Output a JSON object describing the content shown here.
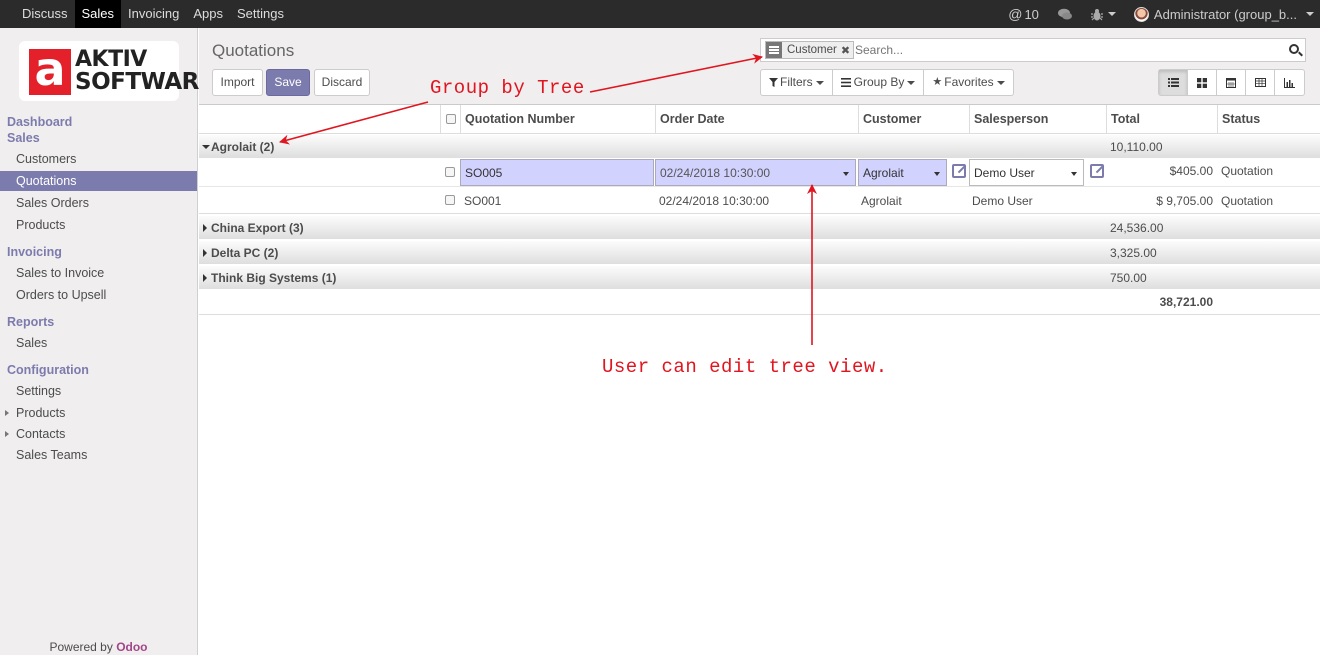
{
  "topbar": {
    "menu": [
      {
        "label": "Discuss",
        "active": false
      },
      {
        "label": "Sales",
        "active": true
      },
      {
        "label": "Invoicing",
        "active": false
      },
      {
        "label": "Apps",
        "active": false
      },
      {
        "label": "Settings",
        "active": false
      }
    ],
    "mentions_count": "10",
    "user_label": "Administrator (group_b..."
  },
  "sidebar": {
    "logo_top": "AKTIV",
    "logo_bottom": "SOFTWARE",
    "logo_letter": "a",
    "sections": {
      "dashboard": "Dashboard",
      "sales": "Sales",
      "invoicing": "Invoicing",
      "reports": "Reports",
      "configuration": "Configuration"
    },
    "items": {
      "customers": "Customers",
      "quotations": "Quotations",
      "sales_orders": "Sales Orders",
      "products": "Products",
      "sales_to_invoice": "Sales to Invoice",
      "orders_to_upsell": "Orders to Upsell",
      "reports_sales": "Sales",
      "settings": "Settings",
      "config_products": "Products",
      "contacts": "Contacts",
      "sales_teams": "Sales Teams"
    },
    "powered_by": "Powered by",
    "powered_brand": "Odoo"
  },
  "cpanel": {
    "breadcrumb": "Quotations",
    "import_label": "Import",
    "save_label": "Save",
    "discard_label": "Discard",
    "search_facet": "Customer",
    "search_placeholder": "Search...",
    "filters_label": "Filters",
    "groupby_label": "Group By",
    "favorites_label": "Favorites"
  },
  "table": {
    "headers": [
      "Quotation Number",
      "Order Date",
      "Customer",
      "Salesperson",
      "Total",
      "Status"
    ],
    "groups": [
      {
        "name": "Agrolait (2)",
        "total": "10,110.00",
        "expanded": true
      },
      {
        "name": "China Export (3)",
        "total": "24,536.00",
        "expanded": false
      },
      {
        "name": "Delta PC (2)",
        "total": "3,325.00",
        "expanded": false
      },
      {
        "name": "Think Big Systems (1)",
        "total": "750.00",
        "expanded": false
      }
    ],
    "rows": [
      {
        "number": "SO005",
        "date": "02/24/2018 10:30:00",
        "customer": "Agrolait",
        "salesperson": "Demo User",
        "total": "$405.00",
        "status": "Quotation",
        "editing": true
      },
      {
        "number": "SO001",
        "date": "02/24/2018 10:30:00",
        "customer": "Agrolait",
        "salesperson": "Demo User",
        "total": "$ 9,705.00",
        "status": "Quotation",
        "editing": false
      }
    ],
    "grand_total": "38,721.00"
  },
  "annotations": {
    "group_by_tree": "Group by Tree",
    "user_can_edit": "User can edit tree view."
  },
  "colors": {
    "accent": "#7c7bad",
    "annotation": "#e0151f",
    "navbar": "#2b2b2b",
    "edit_highlight": "#d2d2ff"
  }
}
